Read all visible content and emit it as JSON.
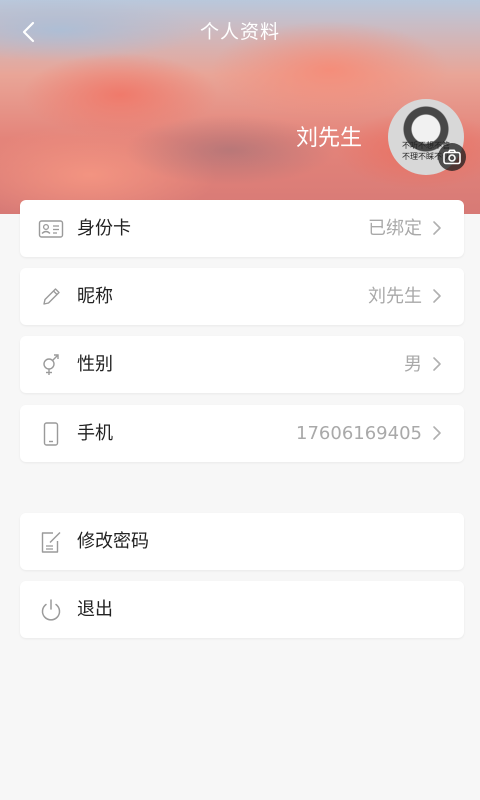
{
  "header": {
    "title": "个人资料",
    "user_name": "刘先生",
    "avatar_caption_line1": "不听不想不管",
    "avatar_caption_line2": "不理不睬不认"
  },
  "profile_items": [
    {
      "label": "身份卡",
      "value": "已绑定",
      "icon": "id-card-icon"
    },
    {
      "label": "昵称",
      "value": "刘先生",
      "icon": "pencil-icon"
    },
    {
      "label": "性别",
      "value": "男",
      "icon": "gender-icon"
    },
    {
      "label": "手机",
      "value": "17606169405",
      "icon": "phone-icon"
    }
  ],
  "action_items": [
    {
      "label": "修改密码",
      "icon": "edit-password-icon"
    },
    {
      "label": "退出",
      "icon": "power-icon"
    }
  ],
  "colors": {
    "label": "#222222",
    "value": "#a9a9a9",
    "icon": "#9a9a9a",
    "background": "#f7f7f7"
  }
}
